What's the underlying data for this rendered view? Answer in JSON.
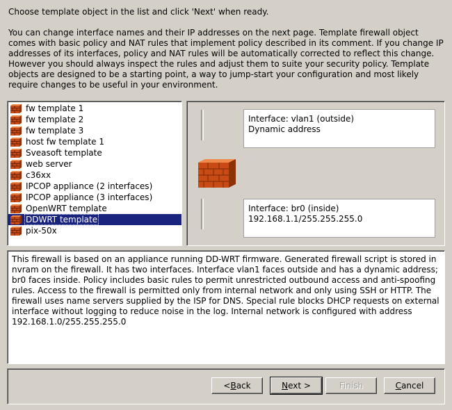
{
  "intro": {
    "line1": "Choose template object in the list and click 'Next' when ready.",
    "paragraph": "You can change  interface names and their IP addresses on the next page. Template firewall object comes with basic policy and NAT rules that implement policy described in its comment. If you change IP addresses of its interfaces, policy and NAT rules will be automatically corrected to reflect this change. However you should always inspect the rules and adjust them to suite your security policy. Template objects are designed to be a starting point, a way to jump-start your configuration and most likely require changes to be useful in your environment."
  },
  "templates": {
    "icon": "firewall-brick-icon",
    "items": [
      "fw template 1",
      "fw template 2",
      "fw template 3",
      "host fw template 1",
      "Sveasoft template",
      "web server",
      "c36xx",
      "IPCOP appliance (2 interfaces)",
      "IPCOP appliance (3 interfaces)",
      "OpenWRT template",
      "DDWRT template",
      "pix-50x"
    ],
    "selected": "DDWRT template"
  },
  "preview": {
    "iface1_line1": "Interface: vlan1 (outside)",
    "iface1_line2": "Dynamic address",
    "iface2_line1": "Interface: br0 (inside)",
    "iface2_line2": "192.168.1.1/255.255.255.0"
  },
  "description": "This firewall is based on an appliance running DD-WRT firmware. Generated firewall script is stored in nvram on the firewall. It has two interfaces. Interface vlan1 faces outside and has a dynamic address; br0 faces inside. Policy includes basic rules to permit unrestricted outbound access and anti-spoofing rules. Access to the firewall is permitted only from internal network and only using SSH or HTTP. The firewall uses name servers supplied by the ISP for DNS. Special rule blocks DHCP requests on external interface without logging to reduce noise in the log. Internal network is configured with address 192.168.1.0/255.255.255.0",
  "buttons": {
    "back_mnemonic": "B",
    "back_rest": "ack",
    "back_prefix": "< ",
    "next_mnemonic": "N",
    "next_rest": "ext >",
    "finish": "Finish",
    "cancel_mnemonic": "C",
    "cancel_rest": "ancel"
  }
}
